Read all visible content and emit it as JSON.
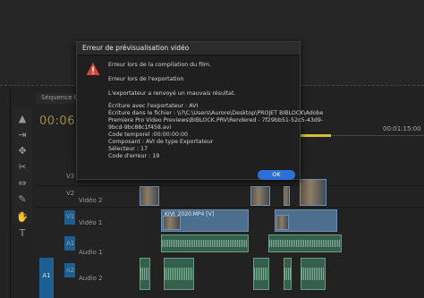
{
  "dialog": {
    "title": "Erreur de prévisualisation vidéo",
    "lines": [
      "Erreur lors de la compilation du film.",
      "Erreur lors de l'exportation",
      "L'exportateur a renvoyé un mauvais résultat.",
      "Écriture avec l'exportateur : AVI",
      "Écriture dans le fichier : \\\\?\\C:\\Users\\Aurore\\Desktop\\PROJET BIBLOCK\\Adobe",
      "Premiere Pro Video Previews\\BIBLOCK.PRV\\Rendered - 7f29bb51-52c5-43d9-",
      "9bcd-9bc88c1f458.avi",
      "Code temporel :00:00:00:00",
      "Composant : AVI de type Exportateur",
      "Sélecteur : 17",
      "Code d'erreur : 19"
    ],
    "ok_label": "OK",
    "colors": {
      "ok": "#2c6fd6",
      "warning": "#e0402e"
    }
  },
  "timeline": {
    "sequence_tab": "Séquence 01",
    "timecode": "00:06:49:2",
    "ruler": [
      "00:01:15:00"
    ],
    "tracks": {
      "v3": "V3",
      "v2": "V2",
      "v2_name": "Vidéo 2",
      "v1": "V1",
      "v1_name": "Vidéo 1",
      "a1": "A1",
      "a1_name": "Audio 1",
      "a2": "A2",
      "a2_name": "Audio 2",
      "a1_source": "A1"
    },
    "clip_label": "KIVI_2020.MP4 [V]",
    "colors": {
      "in_out": "#d6c03a",
      "track_target": "#1c5f92",
      "timecode": "#9a8b4a"
    }
  }
}
